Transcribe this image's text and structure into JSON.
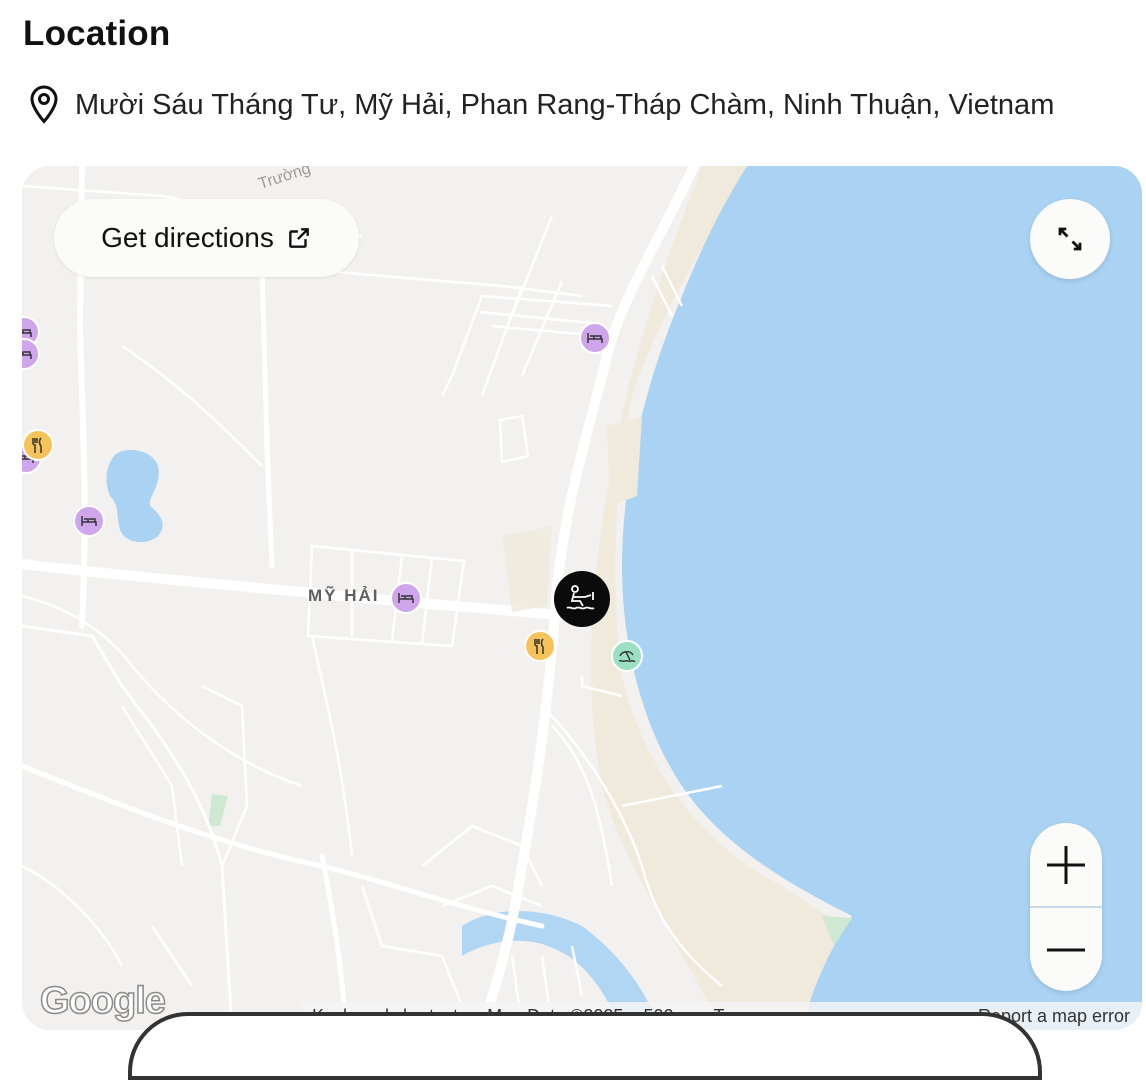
{
  "section_title": "Location",
  "address": "Mười Sáu Tháng Tư, Mỹ Hải, Phan Rang-Tháp Chàm, Ninh Thuận, Vietnam",
  "map": {
    "directions_label": "Get directions",
    "place_label": "MỸ HẢI",
    "road_label": "Trường",
    "google_logo": "Google",
    "attribution": {
      "keyboard": "Keyboard shortcuts",
      "map_data": "Map Data ©2025",
      "scale": "500 m",
      "terms": "Terms",
      "report": "Report a map error"
    },
    "zoom_in_label": "+",
    "zoom_out_label": "−",
    "colors": {
      "water": "#aad3f3",
      "land": "#f2f1f0",
      "hotel": "#cfa6ec",
      "food": "#f6c35a",
      "beach": "#9be0c4"
    },
    "icons": [
      "map-pin-icon",
      "external-link-icon",
      "expand-icon",
      "hotel-bed-icon",
      "restaurant-icon",
      "beach-umbrella-icon",
      "water-ski-icon"
    ]
  }
}
